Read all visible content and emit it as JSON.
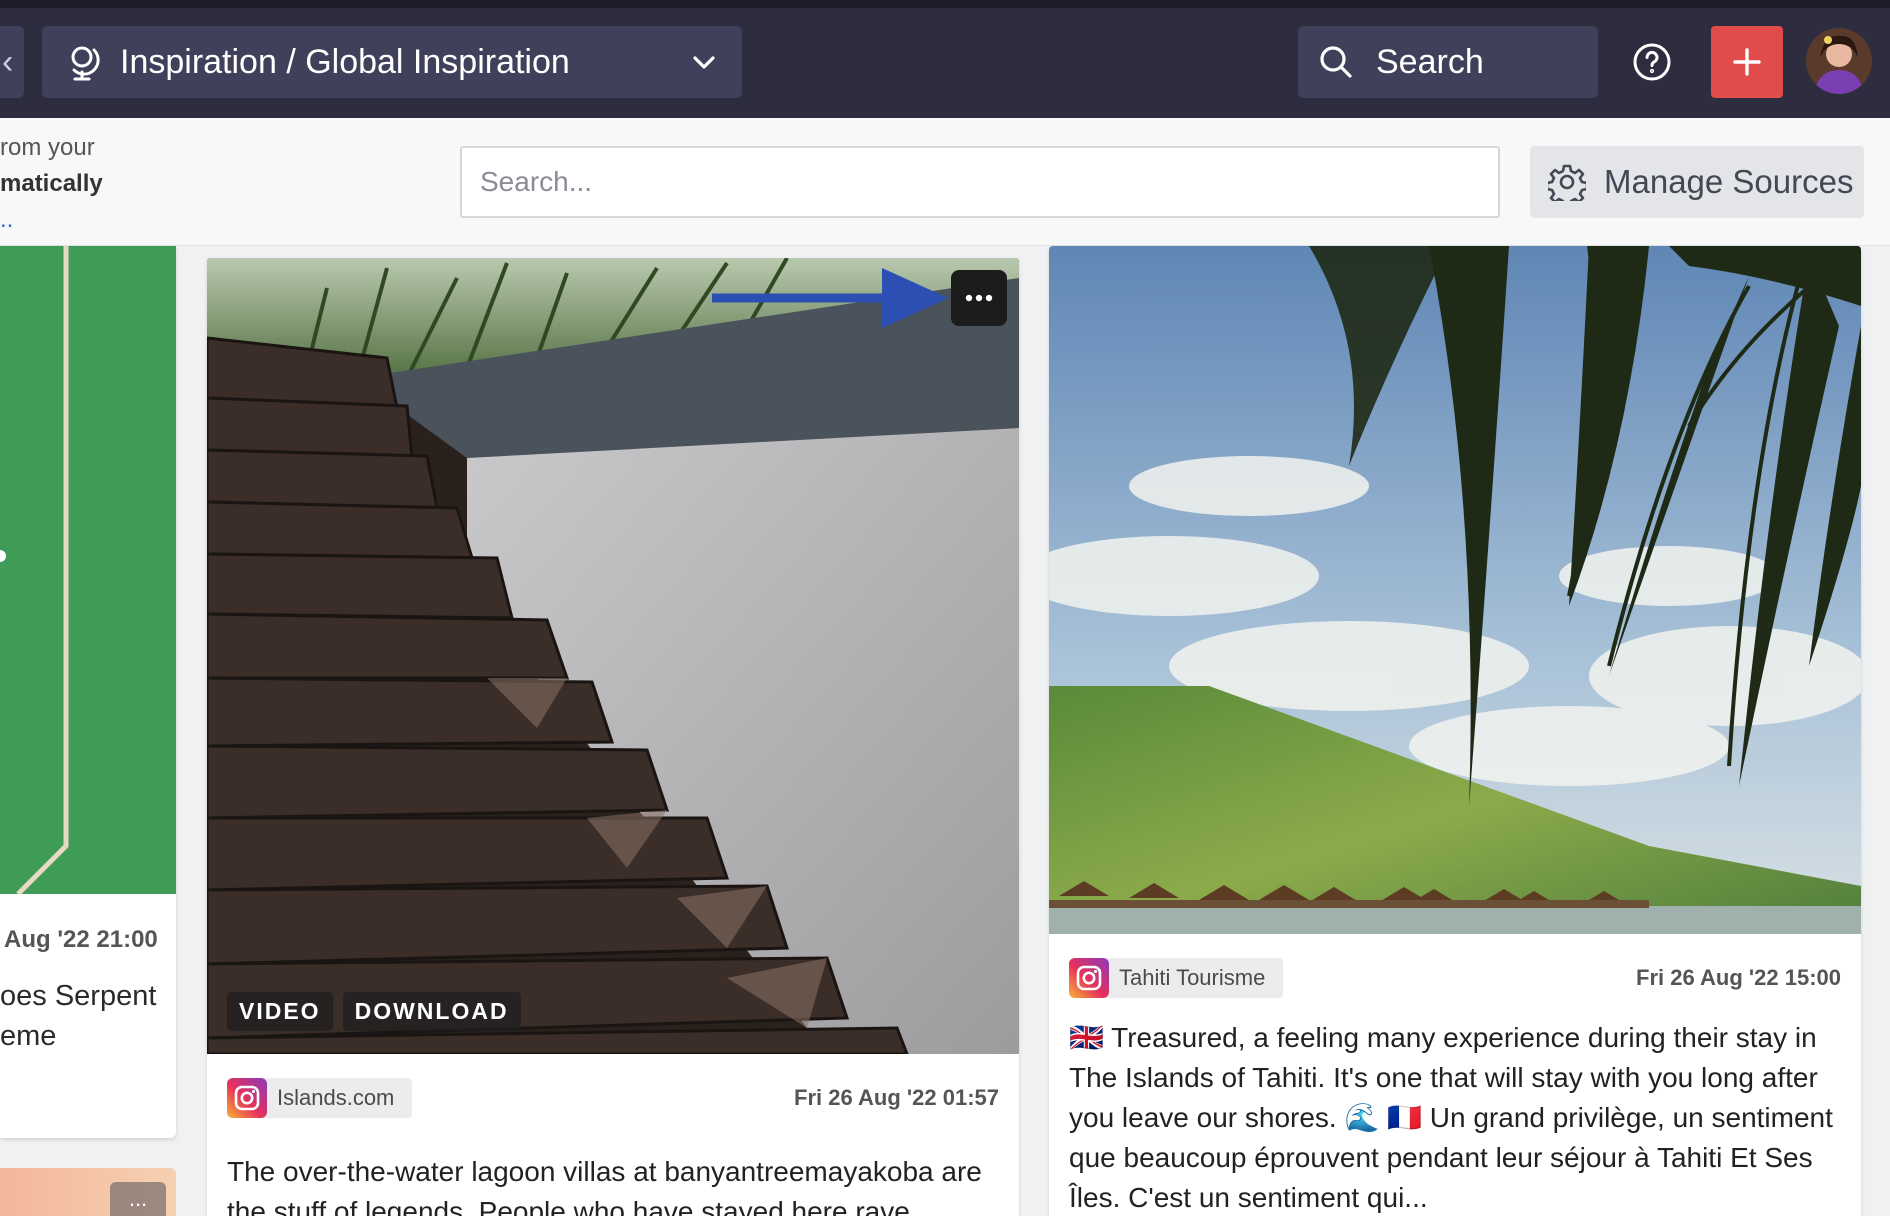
{
  "topbar": {
    "workspace_label": "Inspiration / Global Inspiration",
    "search_label": "Search",
    "accent_color": "#e14c4b"
  },
  "subbar": {
    "intro_line1": "rom your",
    "intro_line2": "matically",
    "intro_line3": "..",
    "filter_placeholder": "Search...",
    "manage_label": "Manage Sources"
  },
  "left_card": {
    "date": "Aug '22 21:00",
    "text_line1": "oes Serpent",
    "text_line2": "eme",
    "more_label": "..."
  },
  "posts": [
    {
      "source": "Islands.com",
      "date": "Fri 26 Aug '22 01:57",
      "badges": [
        "VIDEO",
        "DOWNLOAD"
      ],
      "caption": "The over-the-water lagoon villas at banyantreemayakoba are the stuff of legends. People who have stayed here rave"
    },
    {
      "source": "Tahiti Tourisme",
      "date": "Fri 26 Aug '22 15:00",
      "caption": "🇬🇧 Treasured, a feeling many experience during their stay in The Islands of Tahiti. It's one that will stay with you long after you leave our shores. 🌊 🇫🇷 Un grand privilège, un sentiment que beaucoup éprouvent pendant leur séjour à Tahiti Et Ses Îles. C'est un sentiment qui..."
    }
  ]
}
